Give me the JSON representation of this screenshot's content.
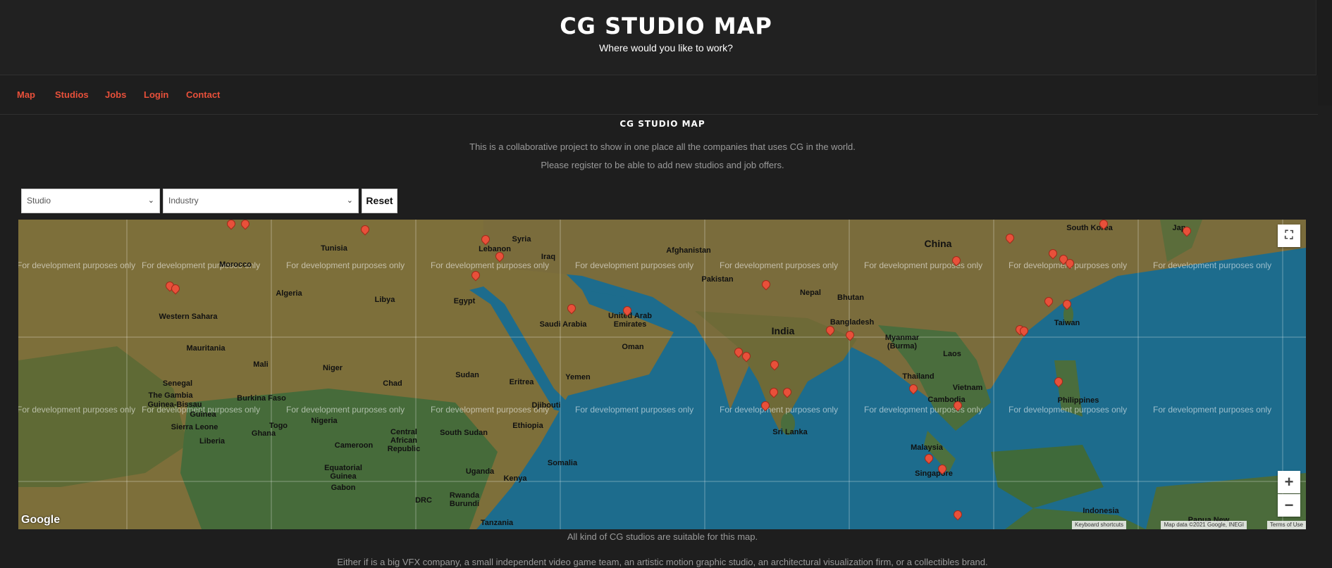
{
  "header": {
    "title": "CG STUDIO MAP",
    "tagline": "Where would you like to work?"
  },
  "nav": {
    "items": [
      {
        "label": "Map"
      },
      {
        "label": "Studios"
      },
      {
        "label": "Jobs"
      },
      {
        "label": "Login"
      },
      {
        "label": "Contact"
      }
    ]
  },
  "page": {
    "heading": "CG STUDIO MAP",
    "intro1": "This is a collaborative project to show in one place all the companies that uses CG in the world.",
    "intro2": "Please register to be able to add new studios and job offers."
  },
  "filters": {
    "studio_value": "Studio",
    "industry_value": "Industry",
    "reset_label": "Reset"
  },
  "map": {
    "watermark": "For development purposes only",
    "google_logo": "Google",
    "attribution": {
      "shortcuts": "Keyboard shortcuts",
      "data": "Map data ©2021 Google, INEGI",
      "terms": "Terms of Use"
    },
    "zoom_in": "+",
    "zoom_out": "−",
    "fullscreen": "⛶",
    "labels": {
      "tunisia": "Tunisia",
      "morocco": "Morocco",
      "algeria": "Algeria",
      "libya": "Libya",
      "egypt": "Egypt",
      "western_sahara": "Western Sahara",
      "mauritania": "Mauritania",
      "mali": "Mali",
      "niger": "Niger",
      "chad": "Chad",
      "sudan": "Sudan",
      "senegal": "Senegal",
      "gambia": "The Gambia",
      "guinea_bissau": "Guinea-Bissau",
      "guinea": "Guinea",
      "sierra_leone": "Sierra Leone",
      "liberia": "Liberia",
      "burkina": "Burkina Faso",
      "ghana": "Ghana",
      "togo": "Togo",
      "nigeria": "Nigeria",
      "cameroon": "Cameroon",
      "car": "Central African Republic",
      "south_sudan": "South Sudan",
      "ethiopia": "Ethiopia",
      "eritrea": "Eritrea",
      "djibouti": "Djibouti",
      "somalia": "Somalia",
      "kenya": "Kenya",
      "uganda": "Uganda",
      "rwanda": "Rwanda",
      "burundi": "Burundi",
      "tanzania": "Tanzania",
      "drc": "DRC",
      "gabon": "Gabon",
      "eq_guinea": "Equatorial Guinea",
      "syria": "Syria",
      "lebanon": "Lebanon",
      "iraq": "Iraq",
      "saudi": "Saudi Arabia",
      "yemen": "Yemen",
      "oman": "Oman",
      "uae": "United Arab Emirates",
      "afghanistan": "Afghanistan",
      "pakistan": "Pakistan",
      "india": "India",
      "nepal": "Nepal",
      "bhutan": "Bhutan",
      "bangladesh": "Bangladesh",
      "myanmar": "Myanmar (Burma)",
      "thailand": "Thailand",
      "laos": "Laos",
      "vietnam": "Vietnam",
      "cambodia": "Cambodia",
      "sri_lanka": "Sri Lanka",
      "malaysia": "Malaysia",
      "singapore": "Singapore",
      "indonesia": "Indonesia",
      "philippines": "Philippines",
      "taiwan": "Taiwan",
      "china": "China",
      "south_korea": "South Korea",
      "japan": "Jap",
      "papua": "Papua New"
    }
  },
  "below": {
    "text1": "All kind of CG studios are suitable for this map.",
    "text2": "Either if is a big VFX company, a small independent video game team, an artistic motion graphic studio, an architectural visualization firm, or a collectibles brand."
  }
}
